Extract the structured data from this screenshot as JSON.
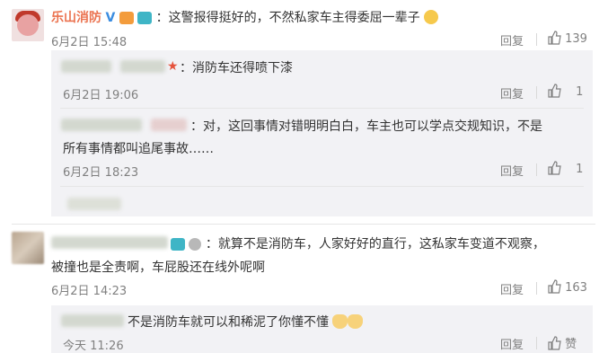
{
  "comments": [
    {
      "username": "乐山消防",
      "text": "：这警报得挺好的，不然私家车主得委屈一辈子",
      "time": "6月2日 15:48",
      "reply_label": "回复",
      "likes": "139"
    },
    {
      "text": "：就算不是消防车，人家好好的直行，这私家车变道不观察，",
      "text2": "被撞也是全责啊，车屁股还在线外呢啊",
      "time": "6月2日 14:23",
      "reply_label": "回复",
      "likes": "163"
    }
  ],
  "replies": [
    {
      "text": "：消防车还得喷下漆",
      "time": "6月2日 19:06",
      "reply_label": "回复",
      "likes": "1"
    },
    {
      "text": "：对，这回事情对错明明白白，车主也可以学点交规知识，不是",
      "text2": "所有事情都叫追尾事故……",
      "time": "6月2日 18:23",
      "reply_label": "回复",
      "likes": "1"
    },
    {
      "text": "不是消防车就可以和稀泥了你懂不懂",
      "time": "今天 11:26",
      "reply_label": "回复",
      "likes": "赞"
    }
  ],
  "colors": {
    "accent": "#eb7350",
    "reply_bg": "#f2f2f5",
    "meta": "#808080"
  },
  "icons": [
    "verified-v-icon",
    "member-badge-icon",
    "thumb-up-icon",
    "smile-emoji-icon",
    "cat-emoji-icon"
  ]
}
